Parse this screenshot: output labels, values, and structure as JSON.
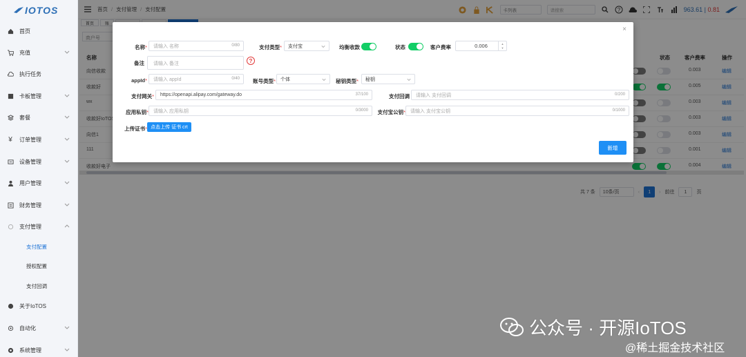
{
  "app": {
    "logo": "IOTOS"
  },
  "sidebar": {
    "items": [
      {
        "label": "首页",
        "icon": "home-icon"
      },
      {
        "label": "充值",
        "icon": "cart-icon"
      },
      {
        "label": "执行任务",
        "icon": "cloud-icon"
      },
      {
        "label": "卡板管理",
        "icon": "card-icon"
      },
      {
        "label": "套餐",
        "icon": "package-icon"
      },
      {
        "label": "订单管理",
        "icon": "yen-icon"
      },
      {
        "label": "设备管理",
        "icon": "device-icon"
      },
      {
        "label": "用户管理",
        "icon": "user-icon"
      },
      {
        "label": "财务管理",
        "icon": "finance-icon"
      },
      {
        "label": "支付管理",
        "icon": "pay-icon"
      },
      {
        "label": "关于IoTOS",
        "icon": "globe-icon"
      },
      {
        "label": "自动化",
        "icon": "auto-icon"
      },
      {
        "label": "系统管理",
        "icon": "settings-icon"
      }
    ],
    "subitems": [
      {
        "label": "支付配置",
        "active": true
      },
      {
        "label": "授权配置",
        "active": false
      },
      {
        "label": "支付回调",
        "active": false
      }
    ]
  },
  "topbar": {
    "breadcrumb": [
      "首页",
      "支付管理",
      "支付配置"
    ],
    "select_placeholder": "卡列表",
    "search_placeholder": "请搜索",
    "stat_main": "963.61",
    "stat_sep": " | ",
    "stat_red": "0.81"
  },
  "tabs": [
    "首页",
    "账",
    "",
    "",
    ""
  ],
  "bg_table": {
    "search_label": "商户号",
    "headers": [
      "名称",
      "状态",
      "客户费率",
      "操作"
    ],
    "rows": [
      {
        "name": "向信收款",
        "rate": "0.003",
        "op": "编辑"
      },
      {
        "name": "收款好",
        "rate": "0.005",
        "op": "编辑"
      },
      {
        "name": "wx",
        "rate": "0.003",
        "op": "编辑"
      },
      {
        "name": "收款好IoTOS",
        "rate": "0.003",
        "op": "编辑"
      },
      {
        "name": "向信1",
        "rate": "0.003",
        "op": "编辑"
      },
      {
        "name": "111",
        "rate": "0.001",
        "op": "编辑"
      },
      {
        "name": "收款好电子",
        "rate": "0.004",
        "op": "编辑"
      }
    ]
  },
  "pager": {
    "total": "共 7 条",
    "size": "10条/页",
    "page": "1",
    "goto_label": "前往",
    "goto_value": "1",
    "goto_unit": "页"
  },
  "modal": {
    "name_label": "名称",
    "name_placeholder": "请输入 名称",
    "name_count": "0/80",
    "paytype_label": "支付类型",
    "paytype_value": "支付宝",
    "balance_label": "均衡收款",
    "status_label": "状态",
    "rate_label": "客户费率",
    "rate_value": "0.006",
    "remark_label": "备注",
    "remark_placeholder": "请输入 备注",
    "appid_label": "appId",
    "appid_placeholder": "请输入 appId",
    "appid_count": "0/40",
    "acctype_label": "账号类型",
    "acctype_value": "个体",
    "keytype_label": "秘钥类型",
    "keytype_value": "秘钥",
    "gateway_label": "支付网关",
    "gateway_value": "https://openapi.alipay.com/gateway.do",
    "gateway_count": "37/100",
    "callback_label": "支付回调",
    "callback_placeholder": "请输入 支付回调",
    "callback_count": "0/200",
    "privkey_label": "应用私钥",
    "privkey_placeholder": "请输入 应用私钥",
    "privkey_count": "0/3000",
    "pubkey_label": "支付宝公钥",
    "pubkey_placeholder": "请输入 支付宝公钥",
    "pubkey_count": "0/1000",
    "cert_label": "上传证书",
    "cert_button": "点击上传 证书 crt",
    "submit": "新增"
  },
  "watermark": {
    "main": "公众号 · 开源IoTOS",
    "sub": "@稀土掘金技术社区"
  }
}
